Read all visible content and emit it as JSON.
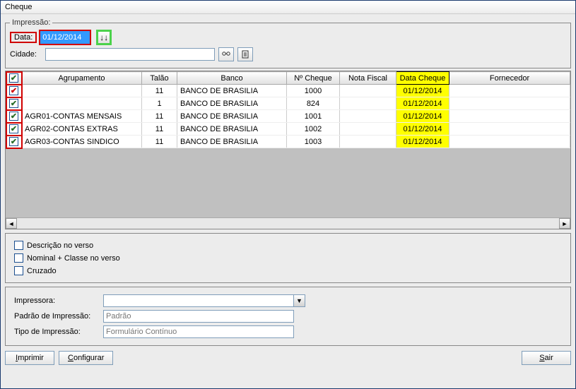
{
  "title": "Cheque",
  "impressao": {
    "legend": "Impressão:",
    "data_label": "Data:",
    "data_value": "01/12/2014",
    "arrows": "↓↓",
    "cidade_label": "Cidade:",
    "cidade_value": "",
    "binoculars": "🔍",
    "doc": "📋"
  },
  "grid": {
    "headers": {
      "agrupamento": "Agrupamento",
      "talao": "Talão",
      "banco": "Banco",
      "num_cheque": "Nº Cheque",
      "nota_fiscal": "Nota Fiscal",
      "data_cheque": "Data Cheque",
      "fornecedor": "Fornecedor"
    },
    "rows": [
      {
        "agrupamento": "",
        "talao": "11",
        "banco": "BANCO DE BRASILIA",
        "num_cheque": "1000",
        "nota_fiscal": "",
        "data_cheque": "01/12/2014",
        "fornecedor": ""
      },
      {
        "agrupamento": "",
        "talao": "1",
        "banco": "BANCO DE BRASILIA",
        "num_cheque": "824",
        "nota_fiscal": "",
        "data_cheque": "01/12/2014",
        "fornecedor": ""
      },
      {
        "agrupamento": "AGR01-CONTAS MENSAIS",
        "talao": "11",
        "banco": "BANCO DE BRASILIA",
        "num_cheque": "1001",
        "nota_fiscal": "",
        "data_cheque": "01/12/2014",
        "fornecedor": ""
      },
      {
        "agrupamento": "AGR02-CONTAS EXTRAS",
        "talao": "11",
        "banco": "BANCO DE BRASILIA",
        "num_cheque": "1002",
        "nota_fiscal": "",
        "data_cheque": "01/12/2014",
        "fornecedor": ""
      },
      {
        "agrupamento": "AGR03-CONTAS SINDICO",
        "talao": "11",
        "banco": "BANCO DE BRASILIA",
        "num_cheque": "1003",
        "nota_fiscal": "",
        "data_cheque": "01/12/2014",
        "fornecedor": ""
      }
    ]
  },
  "options": {
    "descricao": "Descrição no verso",
    "nominal": "Nominal + Classe no verso",
    "cruzado": "Cruzado"
  },
  "printer": {
    "impressora_label": "Impressora:",
    "impressora_value": "",
    "padrao_label": "Padrão de Impressão:",
    "padrao_value": "Padrão",
    "tipo_label": "Tipo de Impressão:",
    "tipo_value": "Formulário Contínuo"
  },
  "buttons": {
    "imprimir": "Imprimir",
    "configurar": "Configurar",
    "sair": "Sair"
  }
}
